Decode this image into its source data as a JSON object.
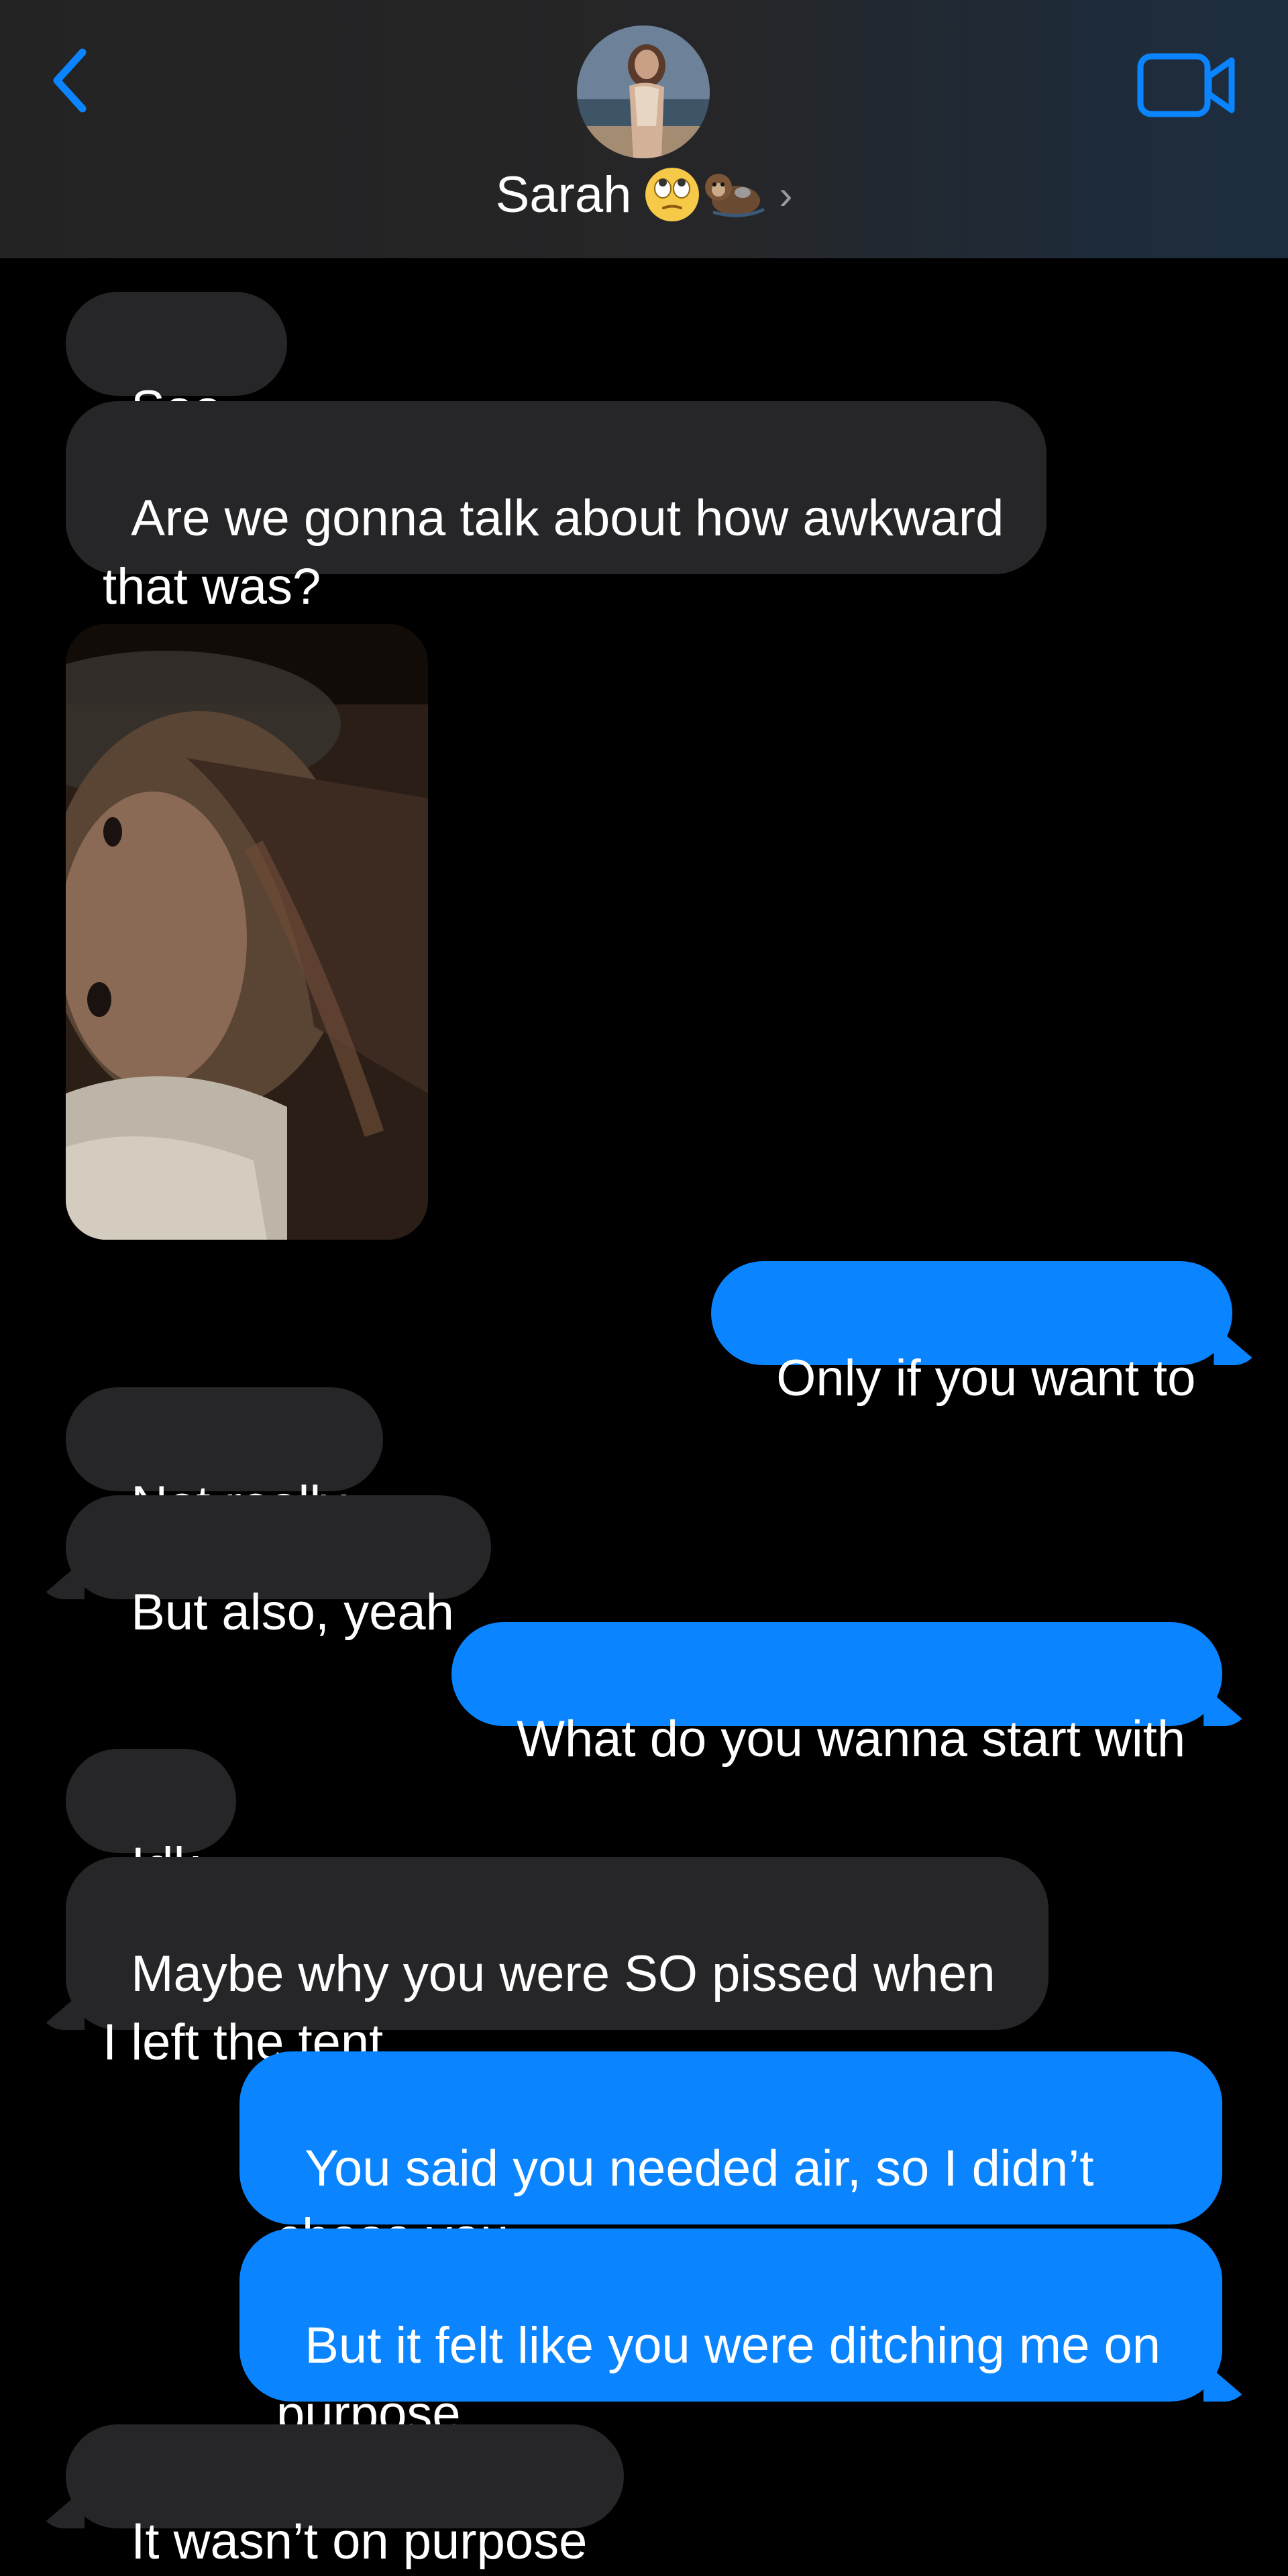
{
  "header": {
    "contact_name": "Sarah",
    "contact_emoji": "🙄🦦",
    "back_icon": "chevron-left-icon",
    "video_icon": "video-camera-icon",
    "accent_color": "#0a84ff"
  },
  "messages": [
    {
      "id": "m1",
      "direction": "incoming",
      "text": "Soo.."
    },
    {
      "id": "m2",
      "direction": "incoming",
      "text": "Are we gonna talk about how awkward that was?"
    },
    {
      "id": "m3",
      "direction": "incoming",
      "type": "photo"
    },
    {
      "id": "m4",
      "direction": "outgoing",
      "text": "Only if you want to"
    },
    {
      "id": "m5",
      "direction": "incoming",
      "text": "Not really"
    },
    {
      "id": "m6",
      "direction": "incoming",
      "text": "But also, yeah"
    },
    {
      "id": "m7",
      "direction": "outgoing",
      "text": "What do you wanna start with"
    },
    {
      "id": "m8",
      "direction": "incoming",
      "text": "Idk"
    },
    {
      "id": "m9",
      "direction": "incoming",
      "text": "Maybe why you were SO pissed when I left the tent"
    },
    {
      "id": "m10",
      "direction": "outgoing",
      "text": "You said you needed air, so I didn’t chase you"
    },
    {
      "id": "m11",
      "direction": "outgoing",
      "text": "But it felt like you were ditching me on purpose"
    },
    {
      "id": "m12",
      "direction": "incoming",
      "text": "It wasn’t on purpose"
    }
  ]
}
